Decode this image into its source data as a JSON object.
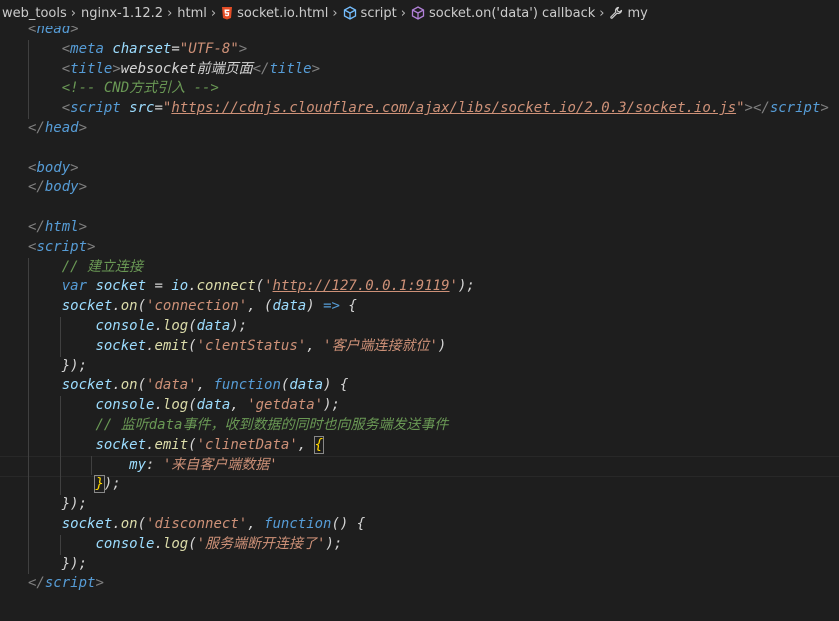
{
  "breadcrumb": {
    "items": [
      {
        "label": "web_tools",
        "icon": "none"
      },
      {
        "label": "nginx-1.12.2",
        "icon": "none"
      },
      {
        "label": "html",
        "icon": "none"
      },
      {
        "label": "socket.io.html",
        "icon": "html5-icon"
      },
      {
        "label": "script",
        "icon": "script-cube-icon"
      },
      {
        "label": "socket.on('data') callback",
        "icon": "method-cube-icon"
      },
      {
        "label": "my",
        "icon": "wrench-icon"
      }
    ],
    "separator": "›"
  },
  "colors": {
    "background": "#1e1e1e",
    "tag": "#569cd6",
    "attribute": "#9cdcfe",
    "string": "#ce9178",
    "comment": "#6a9955",
    "bracket_match": "#ffd700",
    "html5_icon": "#e44d26",
    "cube_icon": "#75beff",
    "method_icon": "#b180d7"
  },
  "code": {
    "lines": [
      [
        {
          "t": "<",
          "c": "punc"
        },
        {
          "t": "head",
          "c": "tag"
        },
        {
          "t": ">",
          "c": "punc"
        }
      ],
      [
        {
          "t": "    "
        },
        {
          "t": "<",
          "c": "punc"
        },
        {
          "t": "meta",
          "c": "tag"
        },
        {
          "t": " "
        },
        {
          "t": "charset",
          "c": "attr"
        },
        {
          "t": "="
        },
        {
          "t": "\"UTF-8\"",
          "c": "str"
        },
        {
          "t": ">",
          "c": "punc"
        }
      ],
      [
        {
          "t": "    "
        },
        {
          "t": "<",
          "c": "punc"
        },
        {
          "t": "title",
          "c": "tag"
        },
        {
          "t": ">",
          "c": "punc"
        },
        {
          "t": "websocket前端页面",
          "c": "txt"
        },
        {
          "t": "</",
          "c": "punc"
        },
        {
          "t": "title",
          "c": "tag"
        },
        {
          "t": ">",
          "c": "punc"
        }
      ],
      [
        {
          "t": "    "
        },
        {
          "t": "<!-- CND方式引入 -->",
          "c": "cmt"
        }
      ],
      [
        {
          "t": "    "
        },
        {
          "t": "<",
          "c": "punc"
        },
        {
          "t": "script",
          "c": "tag"
        },
        {
          "t": " "
        },
        {
          "t": "src",
          "c": "attr"
        },
        {
          "t": "="
        },
        {
          "t": "\"",
          "c": "str"
        },
        {
          "t": "https://cdnjs.cloudflare.com/ajax/libs/socket.io/2.0.3/socket.io.js",
          "c": "link"
        },
        {
          "t": "\"",
          "c": "str"
        },
        {
          "t": "></",
          "c": "punc"
        },
        {
          "t": "script",
          "c": "tag"
        },
        {
          "t": ">",
          "c": "punc"
        }
      ],
      [
        {
          "t": "</",
          "c": "punc"
        },
        {
          "t": "head",
          "c": "tag"
        },
        {
          "t": ">",
          "c": "punc"
        }
      ],
      [],
      [
        {
          "t": "<",
          "c": "punc"
        },
        {
          "t": "body",
          "c": "tag"
        },
        {
          "t": ">",
          "c": "punc"
        }
      ],
      [
        {
          "t": "</",
          "c": "punc"
        },
        {
          "t": "body",
          "c": "tag"
        },
        {
          "t": ">",
          "c": "punc"
        }
      ],
      [],
      [
        {
          "t": "</",
          "c": "punc"
        },
        {
          "t": "html",
          "c": "tag"
        },
        {
          "t": ">",
          "c": "punc"
        }
      ],
      [
        {
          "t": "<",
          "c": "punc"
        },
        {
          "t": "script",
          "c": "tag"
        },
        {
          "t": ">",
          "c": "punc"
        }
      ],
      [
        {
          "t": "    "
        },
        {
          "t": "// 建立连接",
          "c": "cmt"
        }
      ],
      [
        {
          "t": "    "
        },
        {
          "t": "var",
          "c": "kw"
        },
        {
          "t": " "
        },
        {
          "t": "socket",
          "c": "var"
        },
        {
          "t": " = "
        },
        {
          "t": "io",
          "c": "var"
        },
        {
          "t": "."
        },
        {
          "t": "connect",
          "c": "fn"
        },
        {
          "t": "("
        },
        {
          "t": "'",
          "c": "str"
        },
        {
          "t": "http://127.0.0.1:9119",
          "c": "link"
        },
        {
          "t": "'",
          "c": "str"
        },
        {
          "t": ");"
        }
      ],
      [
        {
          "t": "    "
        },
        {
          "t": "socket",
          "c": "var"
        },
        {
          "t": "."
        },
        {
          "t": "on",
          "c": "fn"
        },
        {
          "t": "("
        },
        {
          "t": "'connection'",
          "c": "str"
        },
        {
          "t": ", ("
        },
        {
          "t": "data",
          "c": "var"
        },
        {
          "t": ") "
        },
        {
          "t": "=>",
          "c": "kw"
        },
        {
          "t": " {"
        }
      ],
      [
        {
          "t": "        "
        },
        {
          "t": "console",
          "c": "var"
        },
        {
          "t": "."
        },
        {
          "t": "log",
          "c": "fn"
        },
        {
          "t": "("
        },
        {
          "t": "data",
          "c": "var"
        },
        {
          "t": ");"
        }
      ],
      [
        {
          "t": "        "
        },
        {
          "t": "socket",
          "c": "var"
        },
        {
          "t": "."
        },
        {
          "t": "emit",
          "c": "fn"
        },
        {
          "t": "("
        },
        {
          "t": "'clentStatus'",
          "c": "str"
        },
        {
          "t": ", "
        },
        {
          "t": "'客户端连接就位'",
          "c": "str"
        },
        {
          "t": ")"
        }
      ],
      [
        {
          "t": "    "
        },
        {
          "t": "});"
        }
      ],
      [
        {
          "t": "    "
        },
        {
          "t": "socket",
          "c": "var"
        },
        {
          "t": "."
        },
        {
          "t": "on",
          "c": "fn"
        },
        {
          "t": "("
        },
        {
          "t": "'data'",
          "c": "str"
        },
        {
          "t": ", "
        },
        {
          "t": "function",
          "c": "kw"
        },
        {
          "t": "("
        },
        {
          "t": "data",
          "c": "var"
        },
        {
          "t": ") {"
        }
      ],
      [
        {
          "t": "        "
        },
        {
          "t": "console",
          "c": "var"
        },
        {
          "t": "."
        },
        {
          "t": "log",
          "c": "fn"
        },
        {
          "t": "("
        },
        {
          "t": "data",
          "c": "var"
        },
        {
          "t": ", "
        },
        {
          "t": "'getdata'",
          "c": "str"
        },
        {
          "t": ");"
        }
      ],
      [
        {
          "t": "        "
        },
        {
          "t": "// 监听data事件，收到数据的同时也向服务端发送事件",
          "c": "cmt"
        }
      ],
      [
        {
          "t": "        "
        },
        {
          "t": "socket",
          "c": "var"
        },
        {
          "t": "."
        },
        {
          "t": "emit",
          "c": "fn"
        },
        {
          "t": "("
        },
        {
          "t": "'clinetData'",
          "c": "str"
        },
        {
          "t": ", "
        },
        {
          "t": "{",
          "c": "brk"
        }
      ],
      [
        {
          "t": "            "
        },
        {
          "t": "my",
          "c": "var"
        },
        {
          "t": ": "
        },
        {
          "t": "'来自客户端数据'",
          "c": "str"
        }
      ],
      [
        {
          "t": "        "
        },
        {
          "t": "}",
          "c": "brk"
        },
        {
          "t": ");"
        }
      ],
      [
        {
          "t": "    "
        },
        {
          "t": "});"
        }
      ],
      [
        {
          "t": "    "
        },
        {
          "t": "socket",
          "c": "var"
        },
        {
          "t": "."
        },
        {
          "t": "on",
          "c": "fn"
        },
        {
          "t": "("
        },
        {
          "t": "'disconnect'",
          "c": "str"
        },
        {
          "t": ", "
        },
        {
          "t": "function",
          "c": "kw"
        },
        {
          "t": "() {"
        }
      ],
      [
        {
          "t": "        "
        },
        {
          "t": "console",
          "c": "var"
        },
        {
          "t": "."
        },
        {
          "t": "log",
          "c": "fn"
        },
        {
          "t": "("
        },
        {
          "t": "'服务端断开连接了'",
          "c": "str"
        },
        {
          "t": ");"
        }
      ],
      [
        {
          "t": "    "
        },
        {
          "t": "});"
        }
      ],
      [
        {
          "t": "</",
          "c": "punc"
        },
        {
          "t": "script",
          "c": "tag"
        },
        {
          "t": ">",
          "c": "punc"
        }
      ]
    ],
    "current_line": 22
  }
}
